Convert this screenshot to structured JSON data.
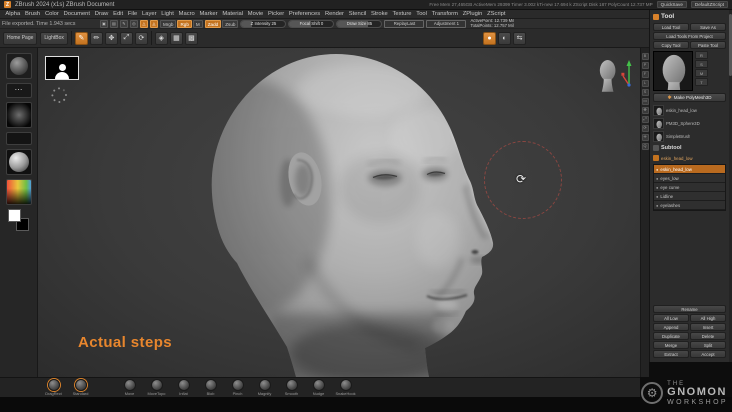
{
  "title_bar": {
    "app_title": "ZBrush 2024 (x1s)   ZBrush Document",
    "stats": "Free Mem 27,465GB   ActiveMem 29399   Timer 3.002 kTi-new 17.694 k   ZScript Disk 187   PolyCount 12.737 MP",
    "quicksave_label": "QuickSave",
    "zscript_label": "DefaultZScript"
  },
  "menu_items": [
    "Alpha",
    "Brush",
    "Color",
    "Document",
    "Draw",
    "Edit",
    "File",
    "Layer",
    "Light",
    "Macro",
    "Marker",
    "Material",
    "Movie",
    "Picker",
    "Preferences",
    "Render",
    "Stencil",
    "Stroke",
    "Texture",
    "Tool",
    "Transform",
    "ZPlugin",
    "ZScript"
  ],
  "status_note": "File exported. Time 1.943 secs",
  "toolbar": {
    "row1_icons": [
      {
        "name": "projection-master-icon",
        "glyph": "▣",
        "active": false
      },
      {
        "name": "lightbox-mini-icon",
        "glyph": "▤",
        "active": false
      },
      {
        "name": "quicksketch-icon",
        "glyph": "✎",
        "active": false
      },
      {
        "name": "spotlight-icon",
        "glyph": "◎",
        "active": false
      },
      {
        "name": "sculptris-pro-icon",
        "glyph": "△",
        "active": true
      },
      {
        "name": "dynamic-subdiv-icon",
        "glyph": "◬",
        "active": true
      }
    ],
    "paint_modes": [
      {
        "label": "Mrgb",
        "active": false
      },
      {
        "label": "Rgb",
        "active": true
      },
      {
        "label": "M",
        "active": false
      }
    ],
    "sculpt_modes": [
      {
        "label": "Zadd",
        "active": true
      },
      {
        "label": "Zsub",
        "active": false
      }
    ],
    "sliders": [
      {
        "label": "Z Intensity",
        "value": "25",
        "fill_style": "width:25%"
      },
      {
        "label": "Focal Shift",
        "value": "0",
        "fill_style": "width:50%"
      },
      {
        "label": "Draw Size",
        "value": "85",
        "fill_style": "width:70%"
      }
    ],
    "selectors": [
      "ReplayLast",
      "Adjustment 1"
    ],
    "counters": [
      "ActivePoint: 12.739 Mil",
      "TotalPoints: 12.757 Mil"
    ]
  },
  "toolbar2": {
    "home_label": "Home Page",
    "lightbox_label": "LightBox",
    "mode_icons": [
      {
        "name": "edit-icon",
        "glyph": "✎",
        "active": true
      },
      {
        "name": "draw-icon",
        "glyph": "✏",
        "active": false
      },
      {
        "name": "move-icon",
        "glyph": "✥",
        "active": false
      },
      {
        "name": "scale-icon",
        "glyph": "⤢",
        "active": false
      },
      {
        "name": "rotate-icon",
        "glyph": "⟳",
        "active": false
      }
    ],
    "aux_icons": [
      {
        "name": "persp-icon",
        "glyph": "◈",
        "active": false
      },
      {
        "name": "floor-icon",
        "glyph": "▦",
        "active": false
      },
      {
        "name": "polyframe-icon",
        "glyph": "▩",
        "active": false
      }
    ],
    "right_icons": [
      {
        "name": "record-timeline-icon",
        "glyph": "●",
        "active": true
      },
      {
        "name": "solo-icon",
        "glyph": "◐",
        "active": false
      },
      {
        "name": "xpose-icon",
        "glyph": "⇆",
        "active": false
      }
    ]
  },
  "right_strip_icons": [
    {
      "name": "bpr-icon",
      "glyph": "B"
    },
    {
      "name": "persp-icon",
      "glyph": "P"
    },
    {
      "name": "floor-icon",
      "glyph": "F"
    },
    {
      "name": "local-icon",
      "glyph": "L"
    },
    {
      "name": "lsym-icon",
      "glyph": "S"
    },
    {
      "name": "frame-icon",
      "glyph": "▭"
    },
    {
      "name": "move-icon",
      "glyph": "✥"
    },
    {
      "name": "scale-icon",
      "glyph": "⤢"
    },
    {
      "name": "rotate-icon",
      "glyph": "⟳"
    },
    {
      "name": "scroll-icon",
      "glyph": "✛"
    },
    {
      "name": "zoom-icon",
      "glyph": "Q"
    }
  ],
  "tool_panel": {
    "header": "Tool",
    "top_buttons": [
      {
        "label": "Load Tool",
        "wide": false
      },
      {
        "label": "Save As",
        "wide": false
      },
      {
        "label": "Load Tools From Project",
        "wide": true
      },
      {
        "label": "Copy Tool",
        "wide": false
      },
      {
        "label": "Paste Tool",
        "wide": false
      }
    ],
    "thumb_minis": [
      {
        "name": "r-button",
        "glyph": "R"
      },
      {
        "name": "s-button",
        "glyph": "S"
      },
      {
        "name": "m-button",
        "glyph": "M"
      },
      {
        "name": "t-button",
        "glyph": "T"
      }
    ],
    "make_polymesh": "Make PolyMesh3D",
    "recent_tools": [
      {
        "label": "eskin_head_low"
      },
      {
        "label": "PM3D_Sphere3D"
      },
      {
        "label": "SimpleBrush"
      }
    ],
    "subtool_header": "Subtool",
    "active_subtool": "eskin_head_low",
    "subtool_items": [
      {
        "name": "eskin_head_low",
        "selected": true
      },
      {
        "name": "eyes_low",
        "selected": false
      },
      {
        "name": "eye curve",
        "selected": false
      },
      {
        "name": "Lidline",
        "selected": false
      },
      {
        "name": "eyelashes",
        "selected": false
      }
    ],
    "subtool_buttons": [
      {
        "label": "Rename",
        "wide": true
      },
      {
        "label": "All Low",
        "wide": false
      },
      {
        "label": "All High",
        "wide": false
      },
      {
        "label": "Append",
        "wide": false
      },
      {
        "label": "Insert",
        "wide": false
      },
      {
        "label": "Duplicate",
        "wide": false
      },
      {
        "label": "Delete",
        "wide": false
      },
      {
        "label": "Merge",
        "wide": false
      },
      {
        "label": "Split",
        "wide": false
      },
      {
        "label": "Extract",
        "wide": false
      },
      {
        "label": "Accept",
        "wide": false
      }
    ]
  },
  "canvas": {
    "annotation": "Actual steps"
  },
  "brush_bar": {
    "left_group": [
      {
        "label": "DragRect",
        "selected": true
      },
      {
        "label": "Standard",
        "selected": true
      }
    ],
    "brushes": [
      {
        "label": "Move",
        "selected": false
      },
      {
        "label": "MoveTopo",
        "selected": false
      },
      {
        "label": "Inflat",
        "selected": false
      },
      {
        "label": "Blob",
        "selected": false
      },
      {
        "label": "Pinch",
        "selected": false
      },
      {
        "label": "Magnify",
        "selected": false
      },
      {
        "label": "Smooth",
        "selected": false
      },
      {
        "label": "Nudge",
        "selected": false
      },
      {
        "label": "SnakeHook",
        "selected": false
      }
    ]
  },
  "watermark": {
    "line1": "THE",
    "line2": "GNOMON",
    "line3": "WORKSHOP"
  },
  "colors": {
    "accent": "#d9822b",
    "canvas_bg": "#3a3a3a",
    "annotation": "#e8862d"
  }
}
